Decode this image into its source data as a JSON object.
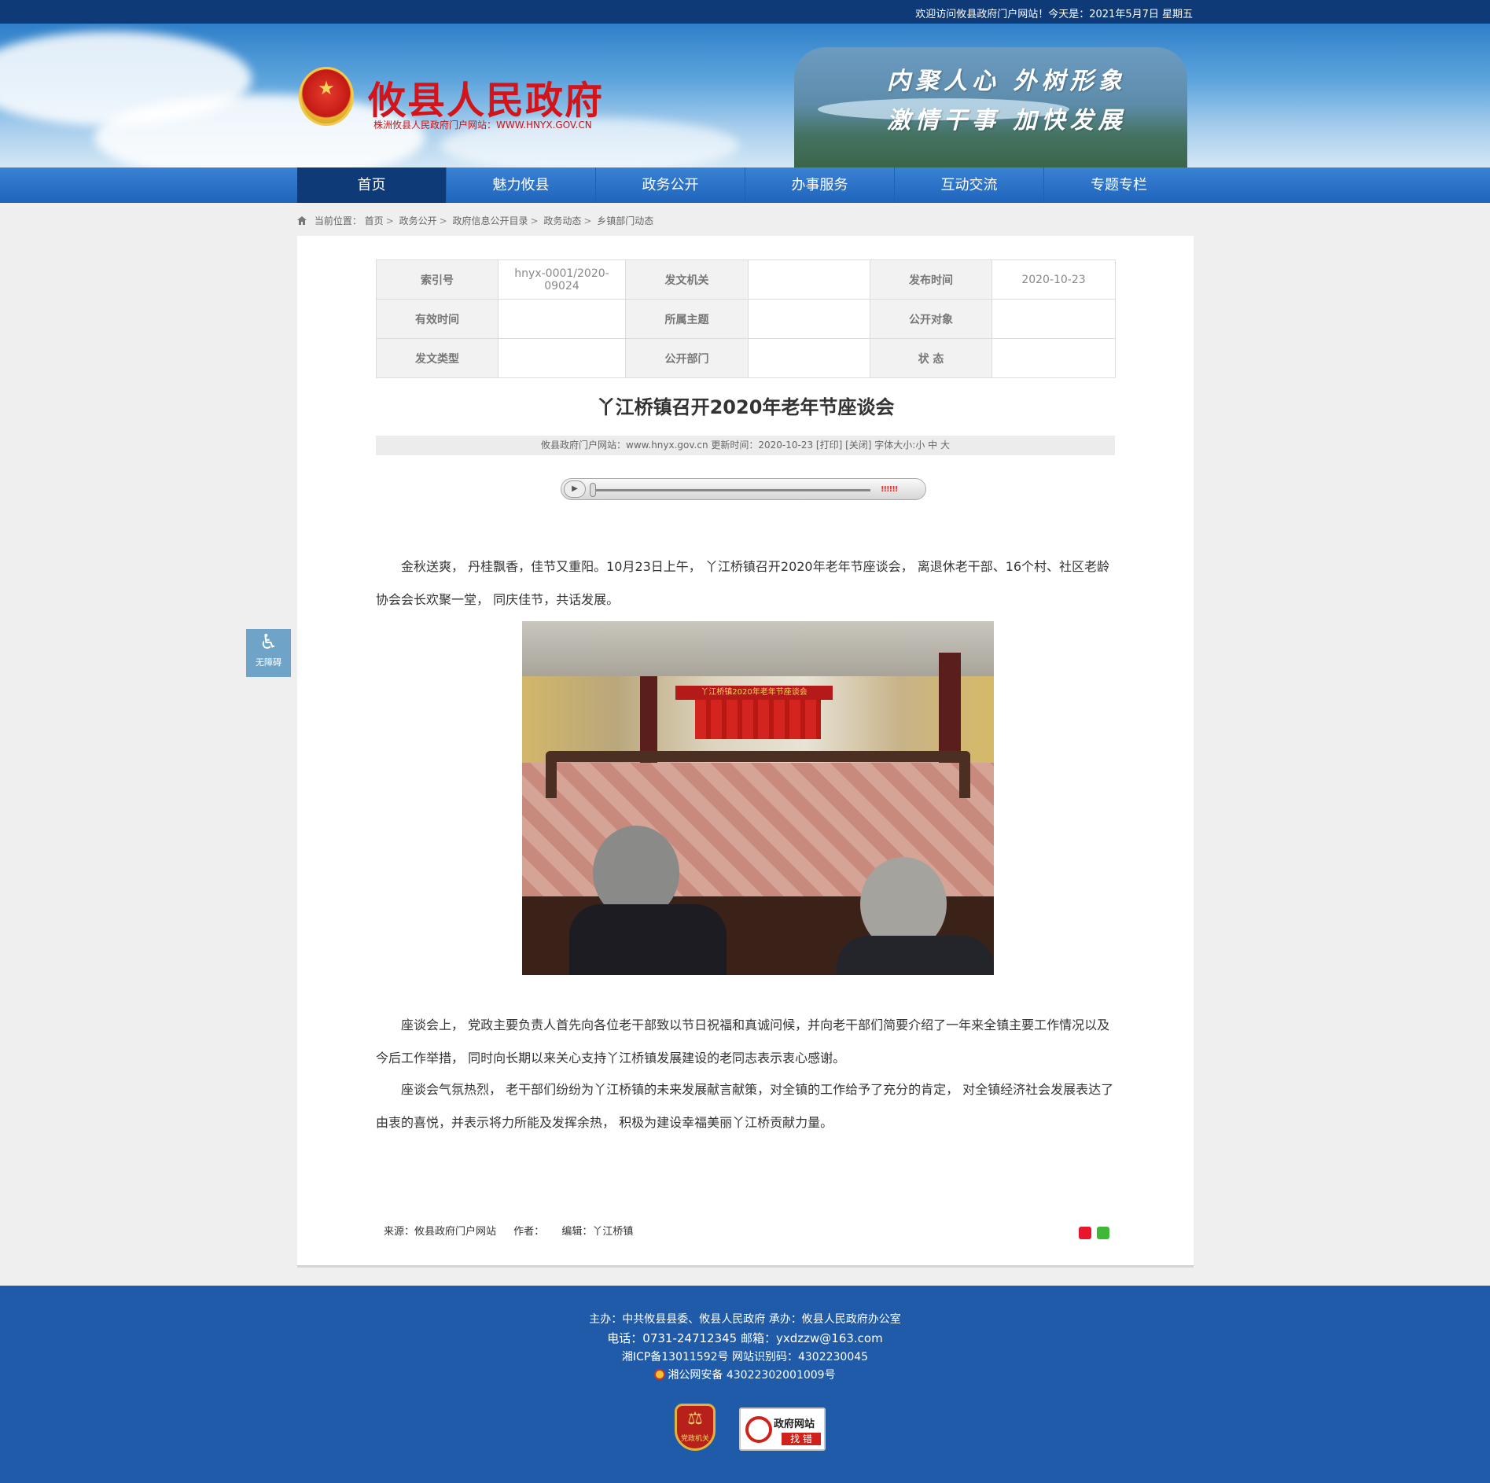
{
  "topbar": {
    "welcome": "欢迎访问攸县政府门户网站！今天是：2021年5月7日 星期五"
  },
  "header": {
    "site_title": "攸县人民政府",
    "site_subtitle": "株洲攸县人民政府门户网站：WWW.HNYX.GOV.CN",
    "slogan_line1": "内聚人心  外树形象",
    "slogan_line2": "激情干事  加快发展"
  },
  "nav": {
    "items": [
      "首页",
      "魅力攸县",
      "政务公开",
      "办事服务",
      "互动交流",
      "专题专栏"
    ],
    "active_index": 0
  },
  "breadcrumb": {
    "prefix": "当前位置：",
    "items": [
      "首页",
      "政务公开",
      "政府信息公开目录",
      "政务动态",
      "乡镇部门动态"
    ]
  },
  "meta_table": {
    "rows": [
      [
        {
          "label": "索引号",
          "value": "hnyx-0001/2020-09024"
        },
        {
          "label": "发文机关",
          "value": ""
        },
        {
          "label": "发布时间",
          "value": "2020-10-23"
        }
      ],
      [
        {
          "label": "有效时间",
          "value": ""
        },
        {
          "label": "所属主题",
          "value": ""
        },
        {
          "label": "公开对象",
          "value": ""
        }
      ],
      [
        {
          "label": "发文类型",
          "value": ""
        },
        {
          "label": "公开部门",
          "value": ""
        },
        {
          "label": "状  态",
          "value": ""
        }
      ]
    ]
  },
  "article": {
    "title": "丫江桥镇召开2020年老年节座谈会",
    "info_bar": "攸县政府门户网站：www.hnyx.gov.cn   更新时间：2020-10-23  [打印]  [关闭]   字体大小:小 中 大",
    "paragraphs": [
      "金秋送爽， 丹桂飘香，佳节又重阳。10月23日上午， 丫江桥镇召开2020年老年节座谈会， 离退休老干部、16个村、社区老龄协会会长欢聚一堂， 同庆佳节，共话发展。",
      "座谈会上， 党政主要负责人首先向各位老干部致以节日祝福和真诚问候，并向老干部们简要介绍了一年来全镇主要工作情况以及今后工作举措， 同时向长期以来关心支持丫江桥镇发展建设的老同志表示衷心感谢。",
      "座谈会气氛热烈， 老干部们纷纷为丫江桥镇的未来发展献言献策，对全镇的工作给予了充分的肯定， 对全镇经济社会发展表达了由衷的喜悦，并表示将力所能及发挥余热， 积极为建设幸福美丽丫江桥贡献力量。"
    ],
    "photo_banner_text": "丫江桥镇2020年老年节座谈会",
    "audio_volume_glyph": "!!!!!!",
    "source": "来源：攸县政府门户网站",
    "author": "作者：",
    "editor": "编辑：丫江桥镇"
  },
  "a11y": {
    "label": "无障碍",
    "icon": "wheelchair-icon"
  },
  "footer": {
    "line1": "主办：中共攸县县委、攸县人民政府 承办：攸县人民政府办公室",
    "line2": "电话：0731-24712345 邮箱：yxdzzw@163.com",
    "line3": "湘ICP备13011592号    网站识别码：4302230045",
    "line4": "湘公网安备 43022302001009号",
    "badge_party": "党政机关",
    "badge_error_title": "政府网站",
    "badge_error_action": "找 错"
  }
}
